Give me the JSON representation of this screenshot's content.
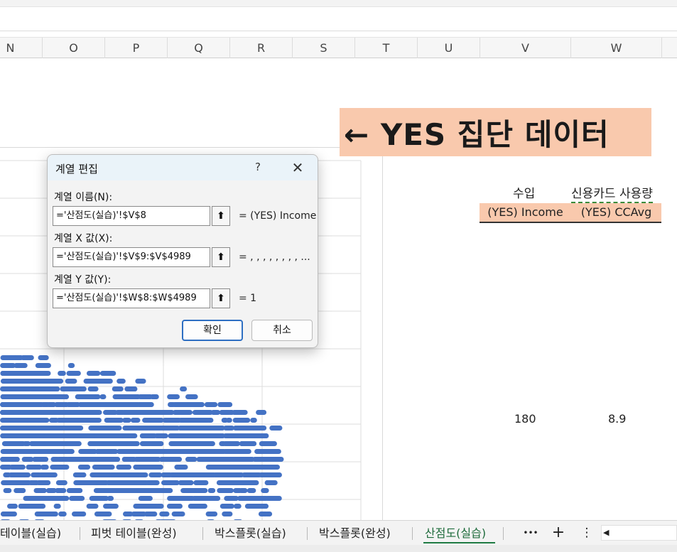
{
  "columns": [
    "N",
    "O",
    "P",
    "Q",
    "R",
    "S",
    "T",
    "U",
    "V",
    "W"
  ],
  "banner_text": "← YES 집단 데이터",
  "headers": {
    "income": "수입",
    "card_usage": "신용카드 사용량"
  },
  "series_labels": {
    "income": "(YES) Income",
    "ccavg": "(YES) CCAvg"
  },
  "values": {
    "income": "180",
    "ccavg": "8.9"
  },
  "dialog": {
    "title": "계열 편집",
    "help": "?",
    "close": "✕",
    "name_label": "계열 이름(N):",
    "name_value": "='산점도(실습)'!$V$8",
    "name_result": "= (YES) Income",
    "x_label": "계열 X 값(X):",
    "x_value": "='산점도(실습)'!$V$9:$V$4989",
    "x_result": "= , , , , , , , , ...",
    "y_label": "계열 Y 값(Y):",
    "y_value": "='산점도(실습)'!$W$8:$W$4989",
    "y_result": "= 1",
    "collapse_icon": "⬆",
    "ok": "확인",
    "cancel": "취소"
  },
  "tabs": [
    {
      "label": "테이블(실습)"
    },
    {
      "label": "피벗 테이블(완성)"
    },
    {
      "label": "박스플롯(실습)"
    },
    {
      "label": "박스플롯(완성)"
    },
    {
      "label": "산점도(실습)",
      "active": true
    }
  ],
  "tab_controls": {
    "more": "•••",
    "add": "+",
    "options": "⋮",
    "scroll_left": "◀"
  },
  "colors": {
    "accent_highlight": "#f9c9ad",
    "point_color": "#4472c4",
    "active_tab": "#1e7a43",
    "dialog_primary": "#2e6fc2"
  },
  "chart_data": {
    "type": "scatter",
    "title": "",
    "xlabel": "",
    "ylabel": "",
    "series": [
      {
        "name": "(YES) Income",
        "x": [],
        "y": []
      }
    ]
  }
}
